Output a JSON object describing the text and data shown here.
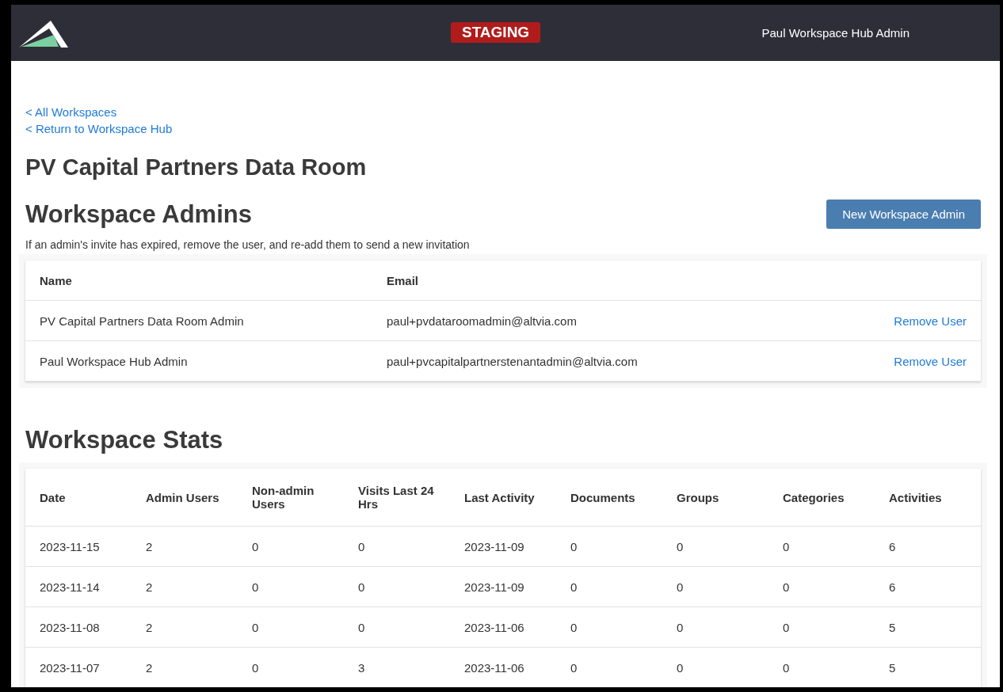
{
  "header": {
    "badge": "STAGING",
    "user": "Paul Workspace Hub Admin"
  },
  "breadcrumbs": [
    {
      "label": "< All Workspaces"
    },
    {
      "label": "< Return to Workspace Hub"
    }
  ],
  "page_title": "PV Capital Partners Data Room",
  "admins": {
    "title": "Workspace Admins",
    "button": "New Workspace Admin",
    "note": "If an admin's invite has expired, remove the user, and re-add them to send a new invitation",
    "columns": [
      "Name",
      "Email"
    ],
    "rows": [
      {
        "name": "PV Capital Partners Data Room Admin",
        "email": "paul+pvdataroomadmin@altvia.com",
        "action": "Remove User"
      },
      {
        "name": "Paul Workspace Hub Admin",
        "email": "paul+pvcapitalpartnerstenantadmin@altvia.com",
        "action": "Remove User"
      }
    ]
  },
  "stats": {
    "title": "Workspace Stats",
    "columns": [
      "Date",
      "Admin Users",
      "Non-admin Users",
      "Visits Last 24 Hrs",
      "Last Activity",
      "Documents",
      "Groups",
      "Categories",
      "Activities"
    ],
    "rows": [
      [
        "2023-11-15",
        "2",
        "0",
        "0",
        "2023-11-09",
        "0",
        "0",
        "0",
        "6"
      ],
      [
        "2023-11-14",
        "2",
        "0",
        "0",
        "2023-11-09",
        "0",
        "0",
        "0",
        "6"
      ],
      [
        "2023-11-08",
        "2",
        "0",
        "0",
        "2023-11-06",
        "0",
        "0",
        "0",
        "5"
      ],
      [
        "2023-11-07",
        "2",
        "0",
        "3",
        "2023-11-06",
        "0",
        "0",
        "0",
        "5"
      ]
    ]
  }
}
